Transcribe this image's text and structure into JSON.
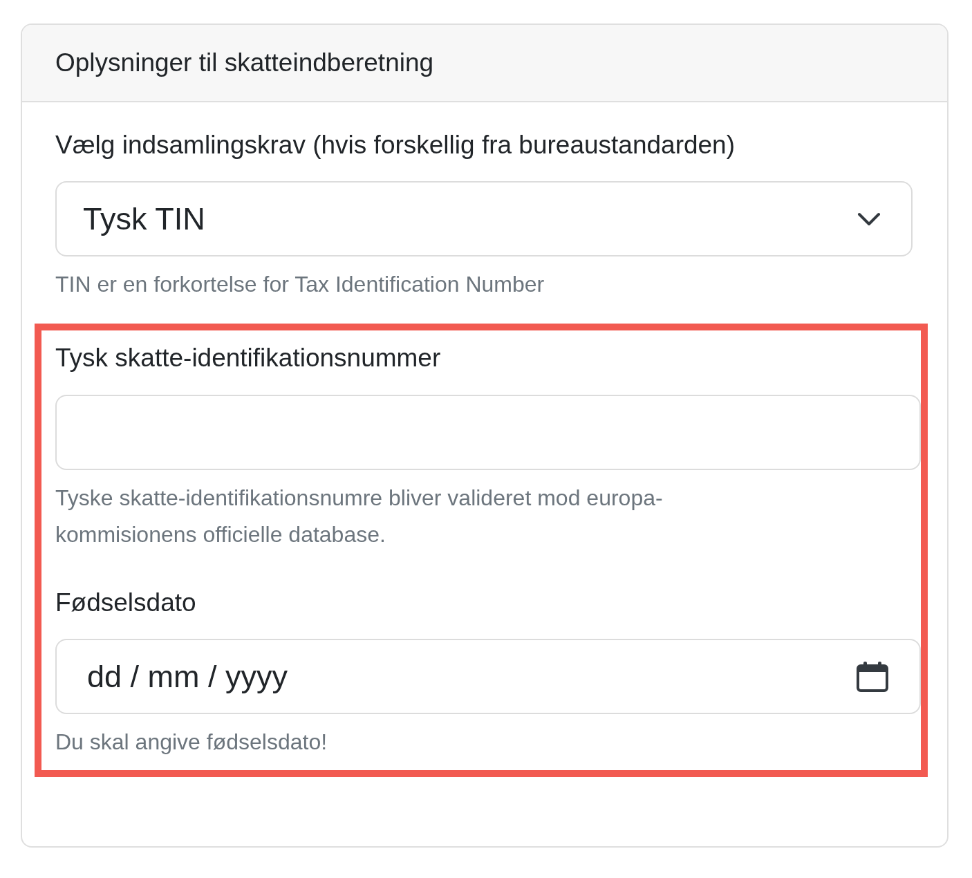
{
  "card": {
    "title": "Oplysninger til skatteindberetning"
  },
  "requirement": {
    "label": "Vælg indsamlingskrav (hvis forskellig fra bureaustandarden)",
    "value": "Tysk TIN",
    "help": "TIN er en forkortelse for Tax Identification Number"
  },
  "highlight_box": {
    "shown": true,
    "fields": [
      {
        "kind": "text",
        "label": "Tysk skatte-identifikationsnummer",
        "help": "Tyske skatte-identifikationsnumre bliver valideret mod europa-kommisionens officielle database."
      },
      {
        "kind": "date",
        "label": "Fødselsdato",
        "placeholder": "dd / mm / yyyy",
        "help": "Du skal angive fødselsdato!"
      }
    ]
  }
}
